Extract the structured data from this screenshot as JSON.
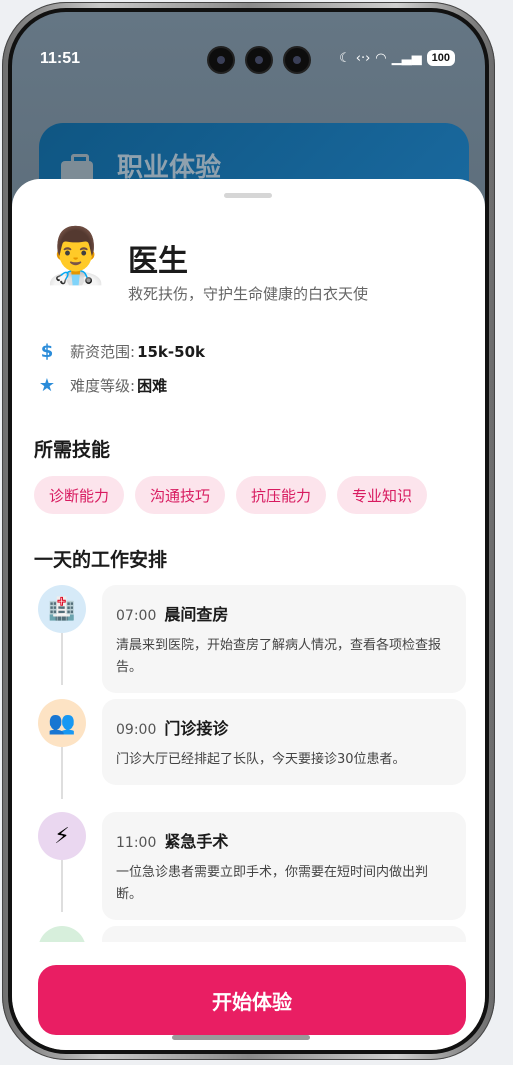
{
  "status_bar": {
    "time": "11:51",
    "battery": "100",
    "icons": [
      "moon-icon",
      "data-sync-icon",
      "wifi-icon",
      "signal-icon"
    ]
  },
  "background_card": {
    "title": "职业体验",
    "icon": "briefcase-icon"
  },
  "profile": {
    "avatar": "👨‍⚕️",
    "title": "医生",
    "subtitle": "救死扶伤，守护生命健康的白衣天使"
  },
  "info": {
    "salary_label": "薪资范围:",
    "salary_value": "15k-50k",
    "difficulty_label": "难度等级:",
    "difficulty_value": "困难"
  },
  "skills_section": {
    "title": "所需技能",
    "items": [
      "诊断能力",
      "沟通技巧",
      "抗压能力",
      "专业知识"
    ]
  },
  "schedule_section": {
    "title": "一天的工作安排",
    "items": [
      {
        "time": "07:00",
        "name": "晨间查房",
        "desc": "清晨来到医院，开始查房了解病人情况，查看各项检查报告。",
        "icon": "🏥"
      },
      {
        "time": "09:00",
        "name": "门诊接诊",
        "desc": "门诊大厅已经排起了长队，今天要接诊30位患者。",
        "icon": "👥"
      },
      {
        "time": "11:00",
        "name": "紧急手术",
        "desc": "一位急诊患者需要立即手术，你需要在短时间内做出判断。",
        "icon": "⚡"
      }
    ]
  },
  "action": {
    "start_label": "开始体验"
  },
  "colors": {
    "accent": "#e91e63",
    "chip_bg": "#fce4ec",
    "info_icon": "#2b8cd9"
  }
}
